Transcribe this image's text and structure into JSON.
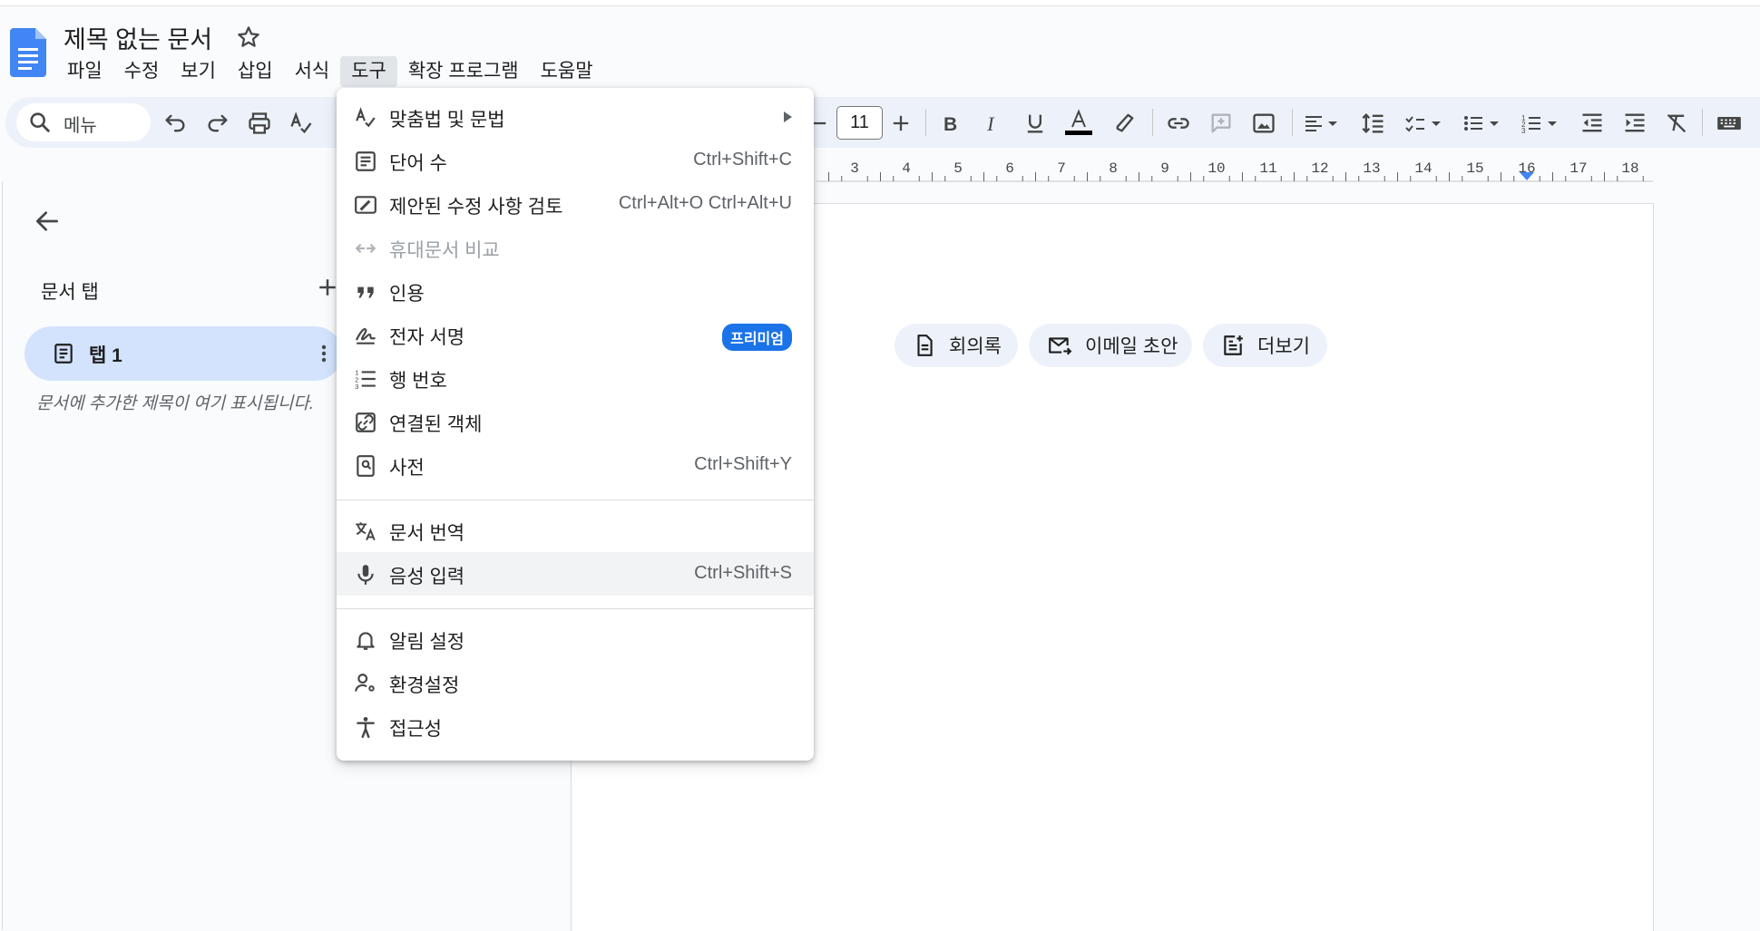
{
  "doc": {
    "title": "제목 없는 문서"
  },
  "menubar": [
    "파일",
    "수정",
    "보기",
    "삽입",
    "서식",
    "도구",
    "확장 프로그램",
    "도움말"
  ],
  "menubar_active": "도구",
  "toolbar": {
    "search_label": "메뉴",
    "font_size": "11"
  },
  "ruler": {
    "ticks": [
      "3",
      "4",
      "5",
      "6",
      "7",
      "8",
      "9",
      "10",
      "11",
      "12",
      "13",
      "14",
      "15",
      "16",
      "17",
      "18"
    ]
  },
  "sidepanel": {
    "tabs_title": "문서 탭",
    "tab_label": "탭 1",
    "hint": "문서에 추가한 제목이 여기 표시됩니다."
  },
  "chips": {
    "meeting_notes": "회의록",
    "email_draft": "이메일 초안",
    "more": "더보기"
  },
  "tools_menu": {
    "spelling": {
      "label": "맞춤법 및 문법"
    },
    "word_count": {
      "label": "단어 수",
      "shortcut": "Ctrl+Shift+C"
    },
    "review_suggestions": {
      "label": "제안된 수정 사항 검토",
      "shortcut": "Ctrl+Alt+O Ctrl+Alt+U"
    },
    "compare": {
      "label": "휴대문서 비교"
    },
    "citations": {
      "label": "인용"
    },
    "esignature": {
      "label": "전자 서명",
      "badge": "프리미엄"
    },
    "line_numbers": {
      "label": "행 번호"
    },
    "linked_objects": {
      "label": "연결된 객체"
    },
    "dictionary": {
      "label": "사전",
      "shortcut": "Ctrl+Shift+Y"
    },
    "translate": {
      "label": "문서 번역"
    },
    "voice_typing": {
      "label": "음성 입력",
      "shortcut": "Ctrl+Shift+S"
    },
    "notifications": {
      "label": "알림 설정"
    },
    "preferences": {
      "label": "환경설정"
    },
    "accessibility": {
      "label": "접근성"
    }
  },
  "colors": {
    "accent": "#1a73e8",
    "toolbar_bg": "#edf2fa",
    "tab_selected": "#d3e3fd",
    "docs_blue": "#4285f4"
  }
}
